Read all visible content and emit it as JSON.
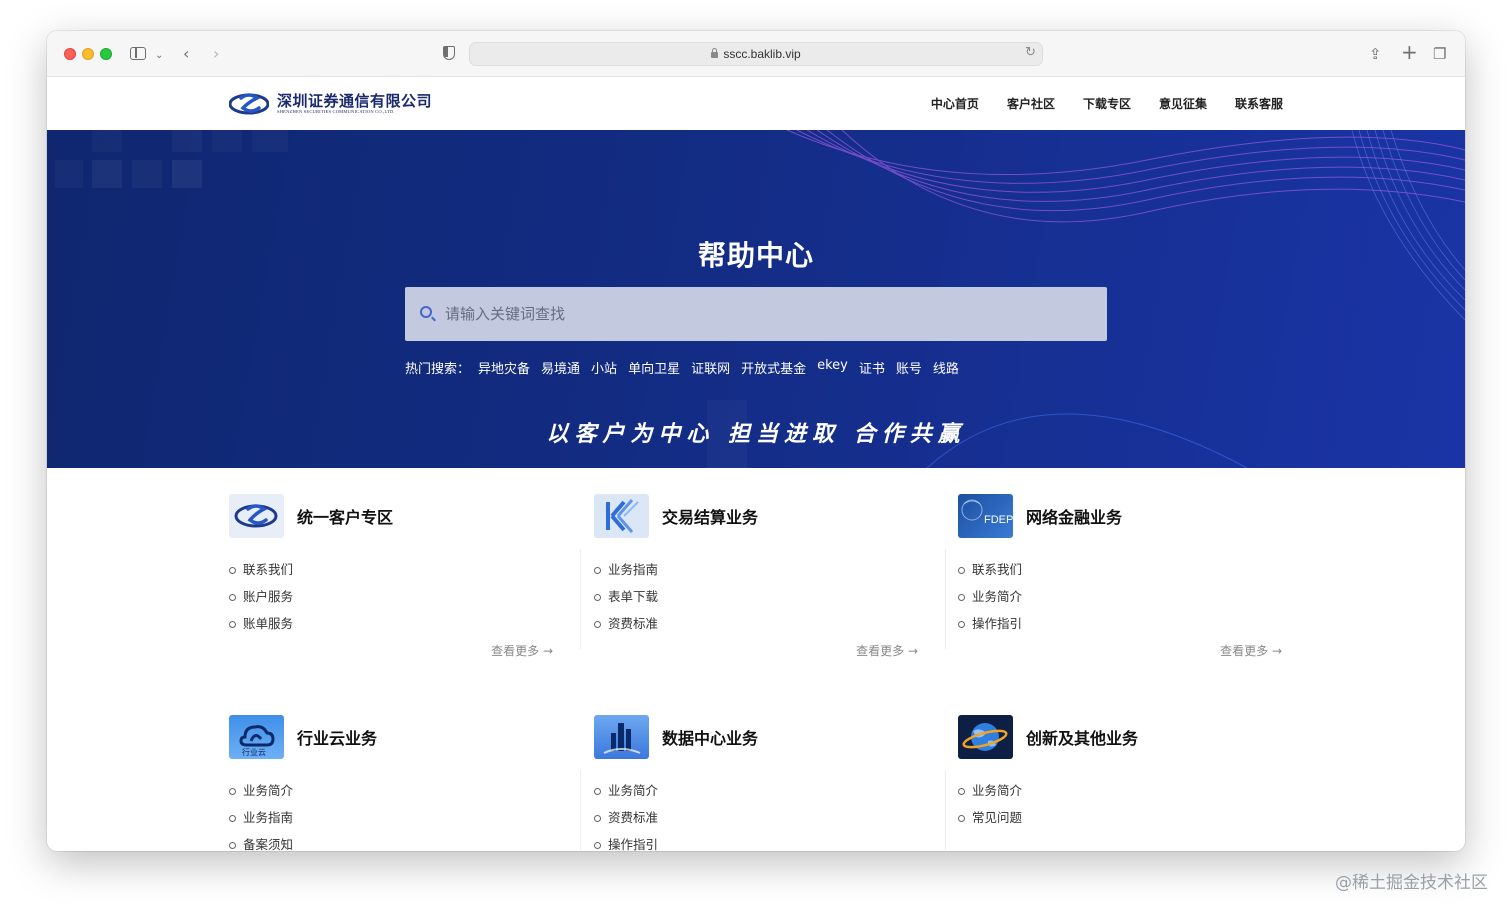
{
  "browser": {
    "url": "sscc.baklib.vip"
  },
  "site": {
    "logo_cn": "深圳证券通信有限公司",
    "logo_en": "SHENZHEN SECURITIES COMMUNICATION CO.,LTD.",
    "nav": [
      "中心首页",
      "客户社区",
      "下载专区",
      "意见征集",
      "联系客服"
    ]
  },
  "hero": {
    "title": "帮助中心",
    "search_placeholder": "请输入关键词查找",
    "hot_label": "热门搜索：",
    "hot_items": [
      "异地灾备",
      "易境通",
      "小站",
      "单向卫星",
      "证联网",
      "开放式基金",
      "ekey",
      "证书",
      "账号",
      "线路"
    ],
    "slogan": "以客户为中心 担当进取 合作共赢"
  },
  "sections": [
    {
      "title": "统一客户专区",
      "icon": "sscc-logo-icon",
      "items": [
        "联系我们",
        "账户服务",
        "账单服务"
      ],
      "more": "查看更多"
    },
    {
      "title": "交易结算业务",
      "icon": "trade-settlement-icon",
      "items": [
        "业务指南",
        "表单下载",
        "资费标准"
      ],
      "more": "查看更多"
    },
    {
      "title": "网络金融业务",
      "icon": "fdep-icon",
      "icon_text": "FDEP",
      "items": [
        "联系我们",
        "业务简介",
        "操作指引"
      ],
      "more": "查看更多"
    },
    {
      "title": "行业云业务",
      "icon": "industry-cloud-icon",
      "icon_text": "行业云",
      "items": [
        "业务简介",
        "业务指南",
        "备案须知"
      ]
    },
    {
      "title": "数据中心业务",
      "icon": "data-center-icon",
      "items": [
        "业务简介",
        "资费标准",
        "操作指引"
      ]
    },
    {
      "title": "创新及其他业务",
      "icon": "innovation-globe-icon",
      "items": [
        "业务简介",
        "常见问题"
      ]
    }
  ],
  "watermark": "@稀土掘金技术社区"
}
